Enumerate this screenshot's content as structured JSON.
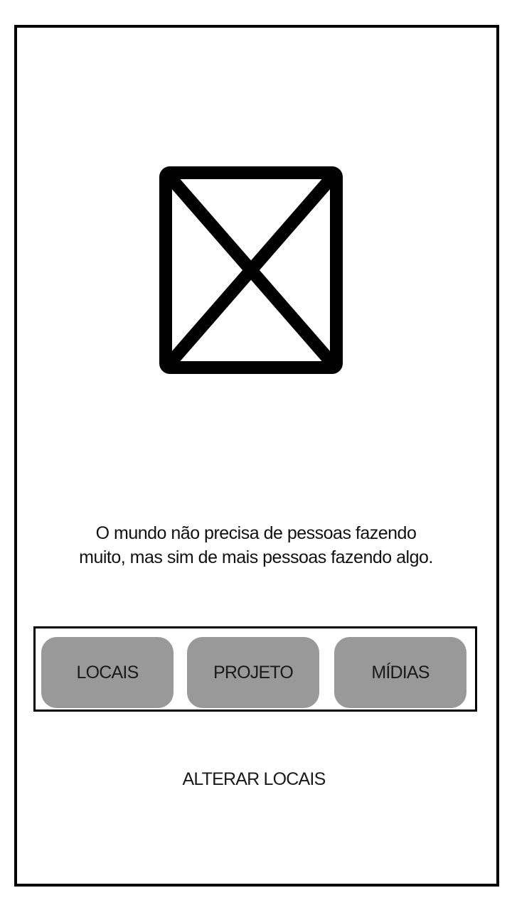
{
  "image_placeholder": {
    "icon": "image-placeholder-icon"
  },
  "quote": {
    "line1": "O mundo não precisa de pessoas fazendo",
    "line2": "muito, mas sim de mais pessoas fazendo algo."
  },
  "tabs": [
    {
      "label": "LOCAIS"
    },
    {
      "label": "PROJETO"
    },
    {
      "label": "MÍDIAS"
    }
  ],
  "actions": {
    "alter_locations_label": "ALTERAR LOCAIS"
  },
  "colors": {
    "tab_background": "#999999",
    "border": "#000000",
    "background": "#ffffff"
  }
}
